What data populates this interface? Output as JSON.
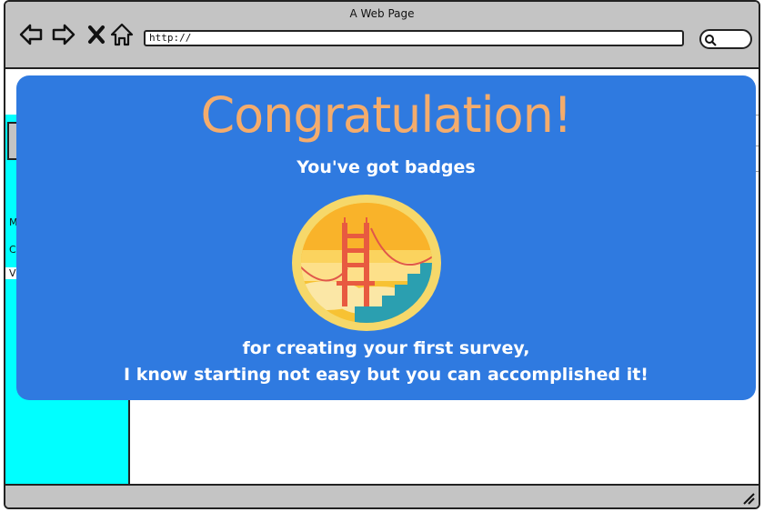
{
  "window": {
    "title": "A Web Page"
  },
  "toolbar": {
    "url": "http://"
  },
  "sidebar": {
    "items": [
      "M",
      "C",
      "V"
    ]
  },
  "modal": {
    "title": "Congratulation!",
    "subtitle": "You've got badges",
    "message_line1": "for creating your first survey,",
    "message_line2": "I know starting not easy but you can accomplished it!"
  },
  "colors": {
    "modal_background": "#2f7ae0",
    "title_color": "#f4ac6c",
    "sidebar": "#00ffff",
    "chrome": "#c4c4c4"
  },
  "badge": {
    "icon": "golden-gate-bridge-badge-icon"
  }
}
